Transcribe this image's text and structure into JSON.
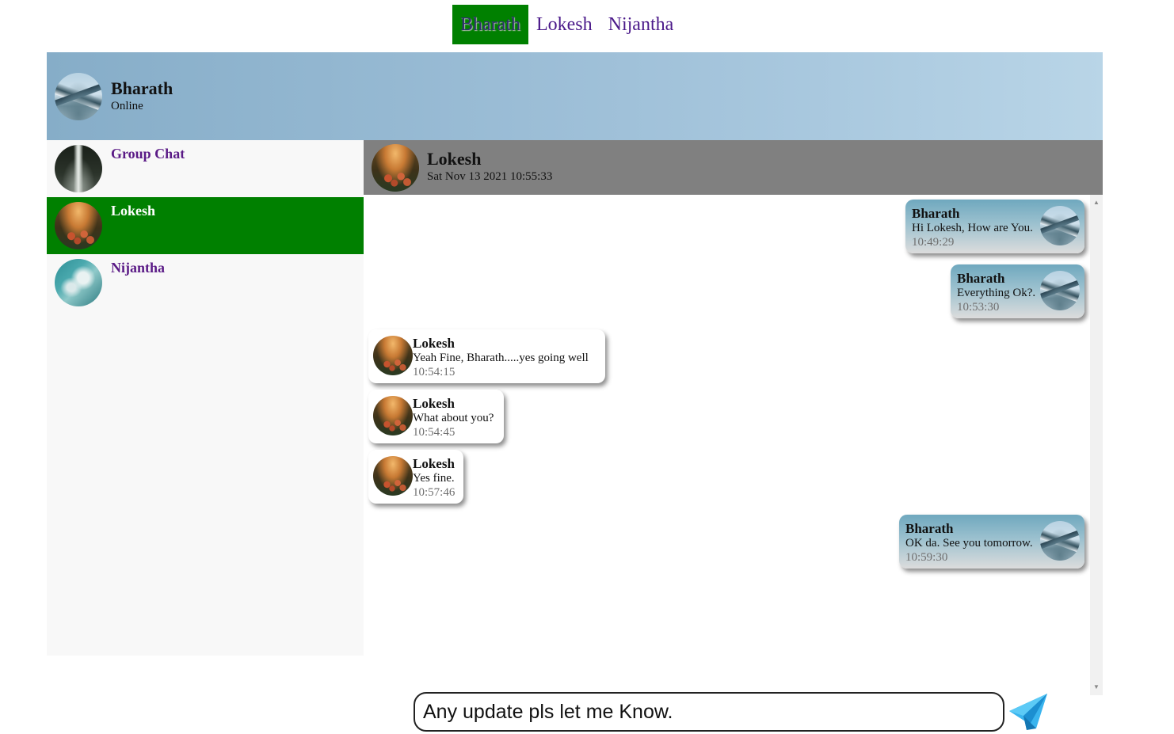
{
  "top_tabs": [
    {
      "label": "Bharath",
      "active": true
    },
    {
      "label": "Lokesh",
      "active": false
    },
    {
      "label": "Nijantha",
      "active": false
    }
  ],
  "current_user": {
    "name": "Bharath",
    "status": "Online",
    "avatar": "mountain-avatar"
  },
  "sidebar": {
    "contacts": [
      {
        "name": "Group Chat",
        "avatar": "waterfall-avatar",
        "active": false
      },
      {
        "name": "Lokesh",
        "avatar": "flowers-avatar",
        "active": true
      },
      {
        "name": "Nijantha",
        "avatar": "ocean-avatar",
        "active": false
      }
    ]
  },
  "chat": {
    "name": "Lokesh",
    "date": "Sat Nov 13 2021 10:55:33",
    "messages": [
      {
        "direction": "out",
        "author": "Bharath",
        "text": "Hi Lokesh, How are You.",
        "time": "10:49:29"
      },
      {
        "direction": "out",
        "author": "Bharath",
        "text": "Everything Ok?.",
        "time": "10:53:30"
      },
      {
        "direction": "in",
        "author": "Lokesh",
        "text": "Yeah Fine, Bharath.....yes going well",
        "time": "10:54:15"
      },
      {
        "direction": "in",
        "author": "Lokesh",
        "text": "What about you?",
        "time": "10:54:45"
      },
      {
        "direction": "in",
        "author": "Lokesh",
        "text": "Yes fine.",
        "time": "10:57:46"
      },
      {
        "direction": "out",
        "author": "Bharath",
        "text": "OK da. See you tomorrow.",
        "time": "10:59:30"
      }
    ]
  },
  "composer": {
    "value": "Any update pls let me Know.",
    "send_icon": "paper-plane-icon"
  },
  "colors": {
    "active_green": "#008000",
    "link_purple": "#5a1a86",
    "header_gray": "#808080"
  }
}
